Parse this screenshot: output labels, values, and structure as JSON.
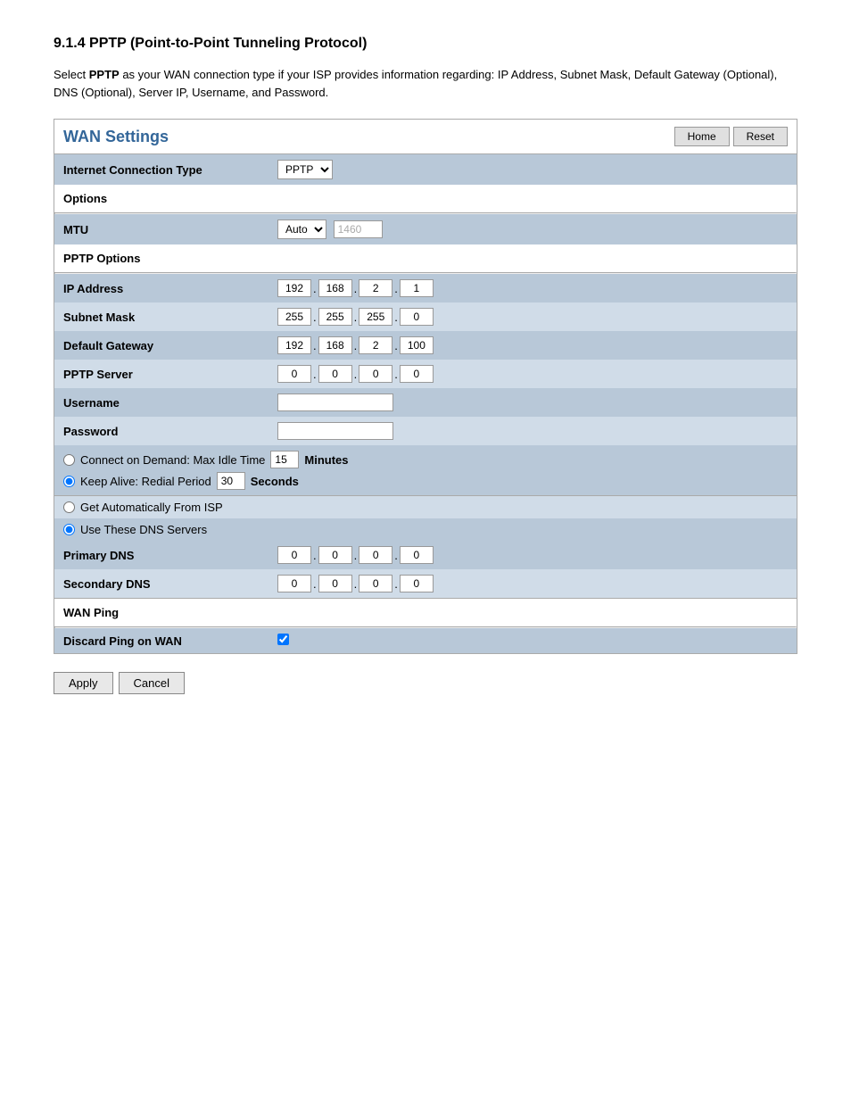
{
  "page": {
    "section_title": "9.1.4 PPTP (Point-to-Point Tunneling Protocol)",
    "intro_text": "Select ",
    "intro_bold": "PPTP",
    "intro_rest": " as your WAN connection type if your ISP provides information regarding: IP Address, Subnet Mask, Default Gateway (Optional), DNS (Optional), Server IP, Username, and Password.",
    "wan_title": "WAN Settings",
    "header_buttons": {
      "home": "Home",
      "reset": "Reset"
    },
    "internet_connection_type_label": "Internet Connection Type",
    "internet_connection_type_value": "PPTP",
    "options_section": "Options",
    "mtu_label": "MTU",
    "mtu_select": "Auto",
    "mtu_value": "1460",
    "pptp_options_section": "PPTP Options",
    "ip_address_label": "IP Address",
    "ip_address": {
      "a": "192",
      "b": "168",
      "c": "2",
      "d": "1"
    },
    "subnet_mask_label": "Subnet Mask",
    "subnet_mask": {
      "a": "255",
      "b": "255",
      "c": "255",
      "d": "0"
    },
    "default_gateway_label": "Default Gateway",
    "default_gateway": {
      "a": "192",
      "b": "168",
      "c": "2",
      "d": "100"
    },
    "pptp_server_label": "PPTP Server",
    "pptp_server": {
      "a": "0",
      "b": "0",
      "c": "0",
      "d": "0"
    },
    "username_label": "Username",
    "username_value": "",
    "password_label": "Password",
    "password_value": "",
    "connect_on_demand_label": "Connect on Demand: Max Idle Time",
    "connect_on_demand_value": "15",
    "minutes_label": "Minutes",
    "keep_alive_label": "Keep Alive: Redial Period",
    "keep_alive_value": "30",
    "seconds_label": "Seconds",
    "get_auto_dns_label": "Get Automatically From ISP",
    "use_these_dns_label": "Use These DNS Servers",
    "primary_dns_label": "Primary DNS",
    "primary_dns": {
      "a": "0",
      "b": "0",
      "c": "0",
      "d": "0"
    },
    "secondary_dns_label": "Secondary DNS",
    "secondary_dns": {
      "a": "0",
      "b": "0",
      "c": "0",
      "d": "0"
    },
    "wan_ping_section": "WAN Ping",
    "discard_ping_label": "Discard Ping on WAN",
    "apply_label": "Apply",
    "cancel_label": "Cancel"
  }
}
